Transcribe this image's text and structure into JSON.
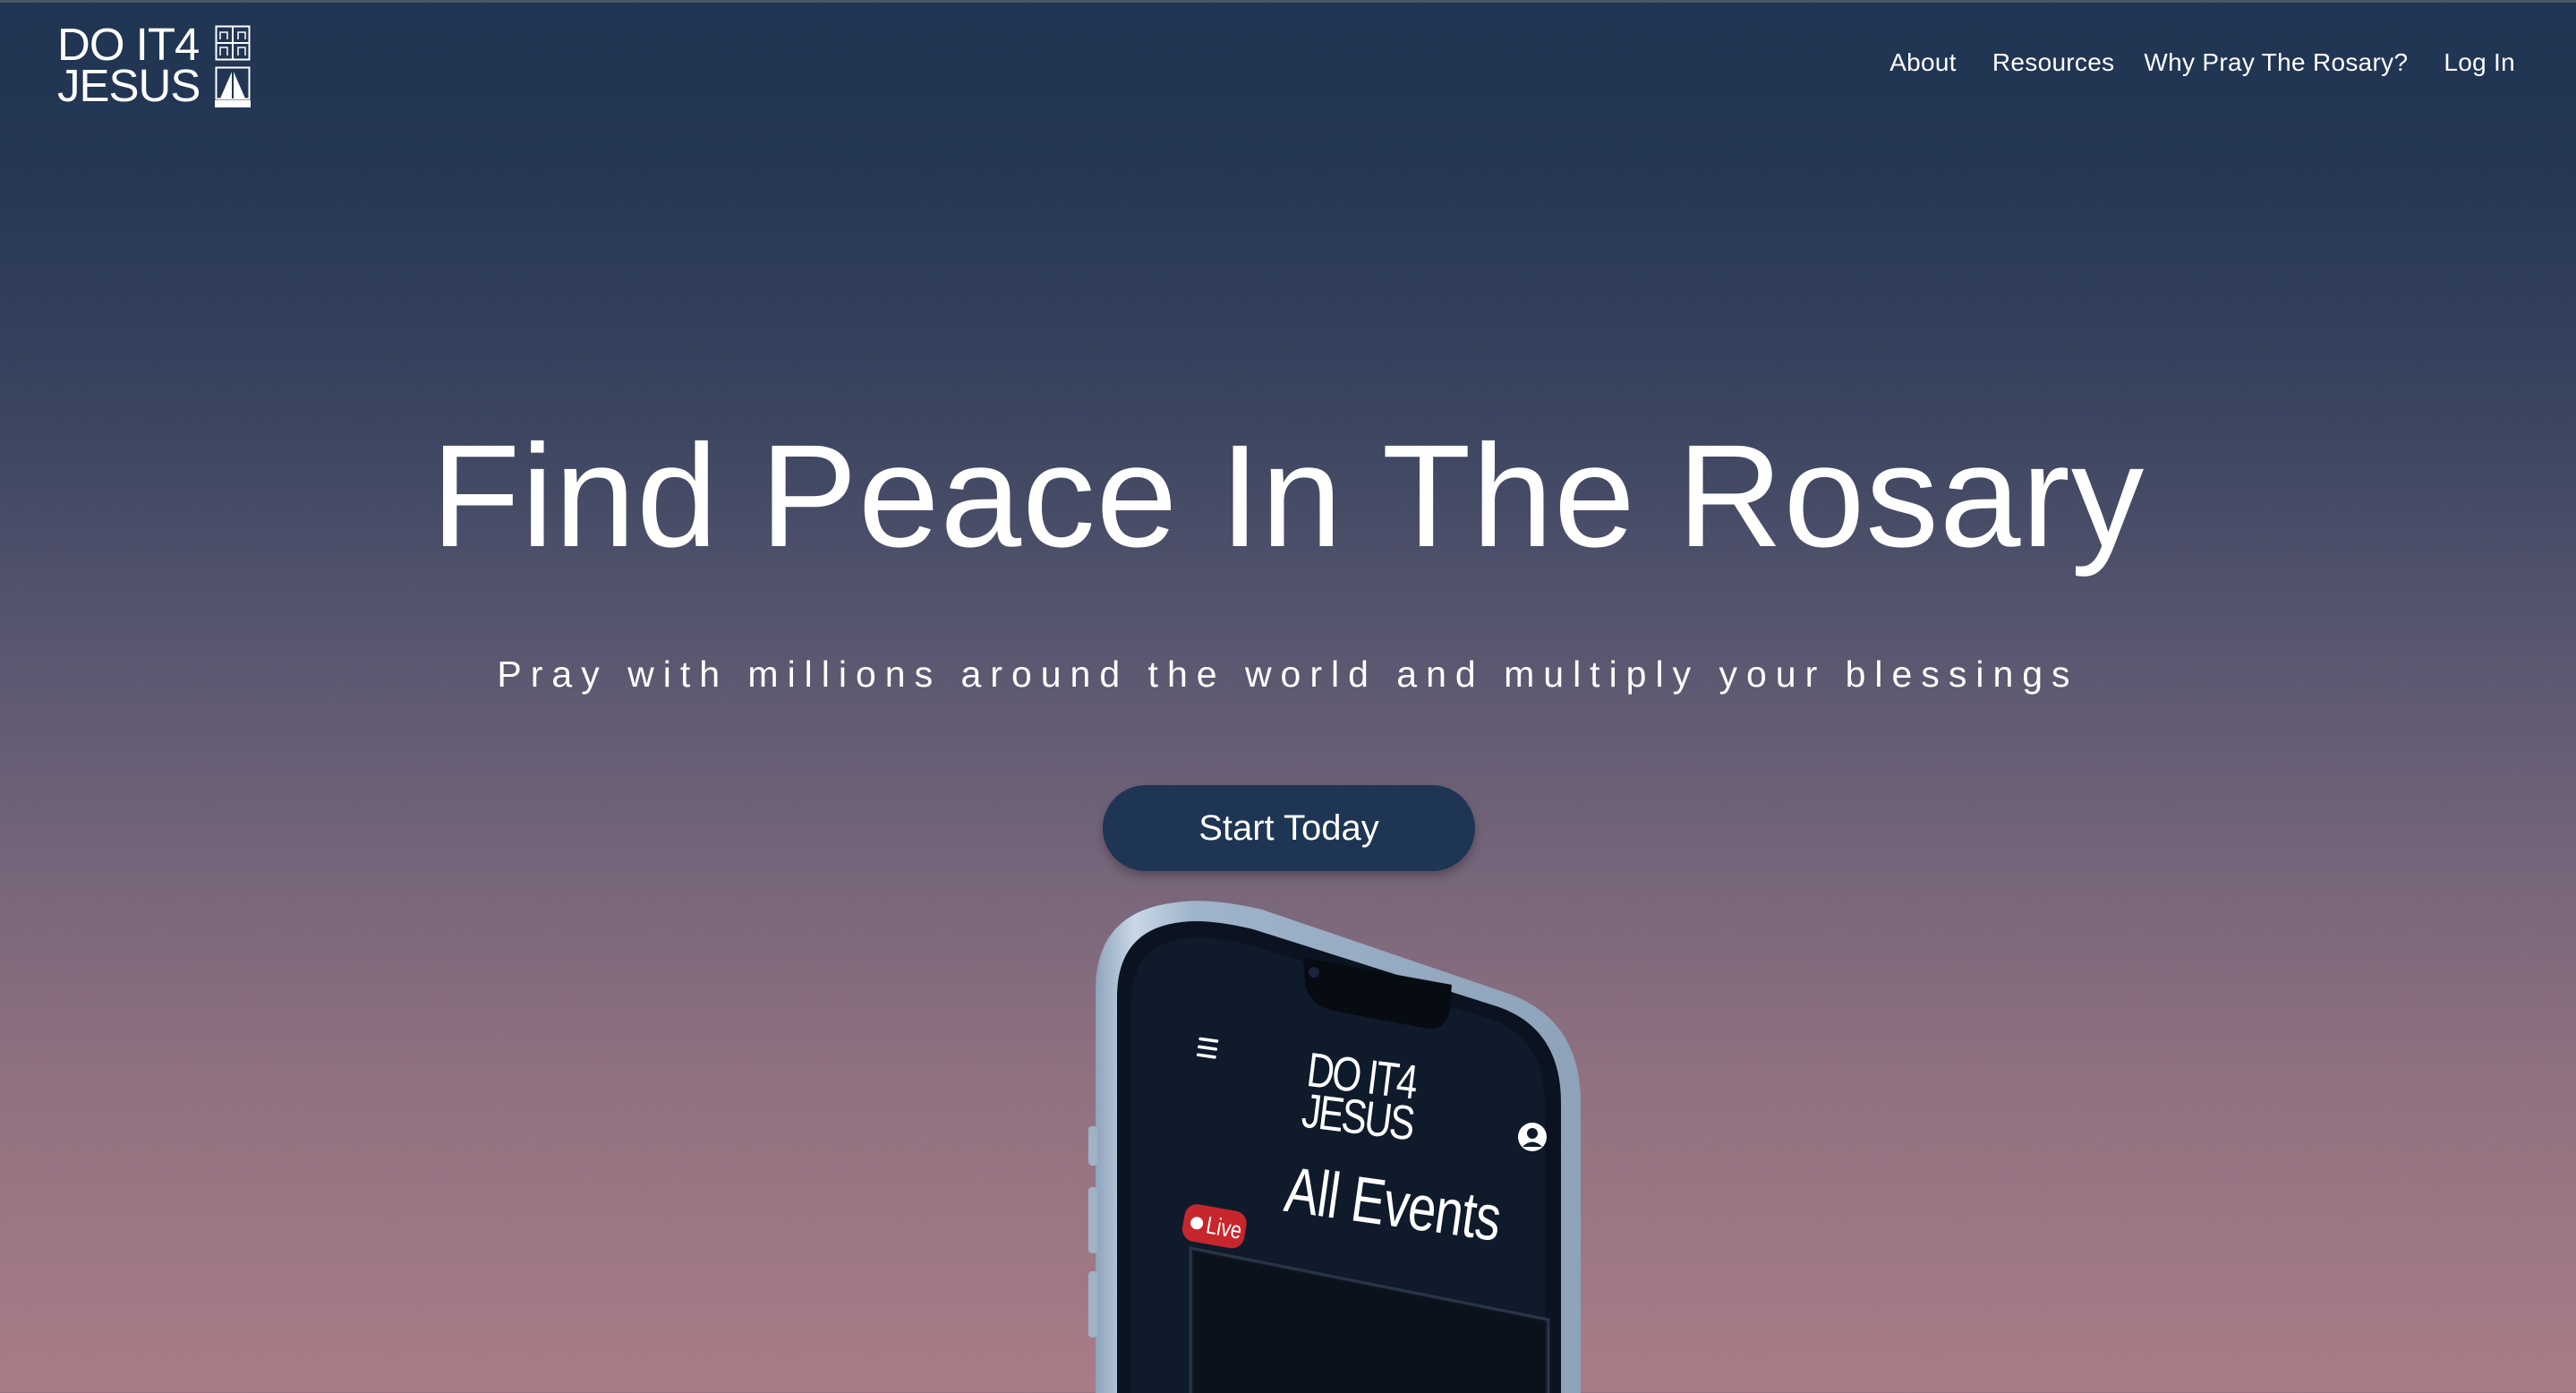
{
  "brand": {
    "line1": "DO IT4",
    "line2": "JESUS",
    "icon": "church-window-and-steps-icon"
  },
  "nav": {
    "items": [
      {
        "label": "About"
      },
      {
        "label": "Resources"
      },
      {
        "label": "Why Pray The Rosary?"
      },
      {
        "label": "Log In"
      }
    ]
  },
  "hero": {
    "title": "Find Peace In The Rosary",
    "subtitle": "Pray with millions around the world and multiply your blessings",
    "cta_label": "Start Today"
  },
  "phone_screen": {
    "menu_icon": "hamburger-menu-icon",
    "logo_line1": "DO IT4",
    "logo_line2": "JESUS",
    "title": "All Events",
    "live_badge": "Live",
    "profile_icon": "user-profile-icon"
  },
  "colors": {
    "gradient_top": "#1f3553",
    "gradient_bottom": "#a97c86",
    "cta_background": "#1e3553",
    "live_badge": "#c8262d",
    "phone_screen": "#0f1b2b",
    "phone_frame": "#a9bdd4"
  }
}
